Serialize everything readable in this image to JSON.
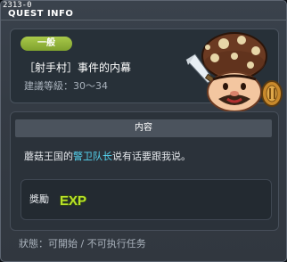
{
  "window": {
    "quest_id": "2313-0",
    "title": "QUEST INFO"
  },
  "quest": {
    "level_badge": "一般",
    "name": "［射手村］事件的内幕",
    "recommended_level": "建議等級：30～34",
    "npc_icon": "mushroom-warrior-npc-icon"
  },
  "content": {
    "header": "内容",
    "text_before": "蘑菇王国的",
    "text_highlight": "警卫队长",
    "text_after": "说有话要跟我说。",
    "highlight_color": "#55d6f2"
  },
  "reward": {
    "label": "獎勵",
    "exp_label": "EXP"
  },
  "status": {
    "text": "狀態：可開始 / 不可执行任务"
  },
  "colors": {
    "badge": "#8fb23a",
    "exp": "#b8e02a"
  }
}
